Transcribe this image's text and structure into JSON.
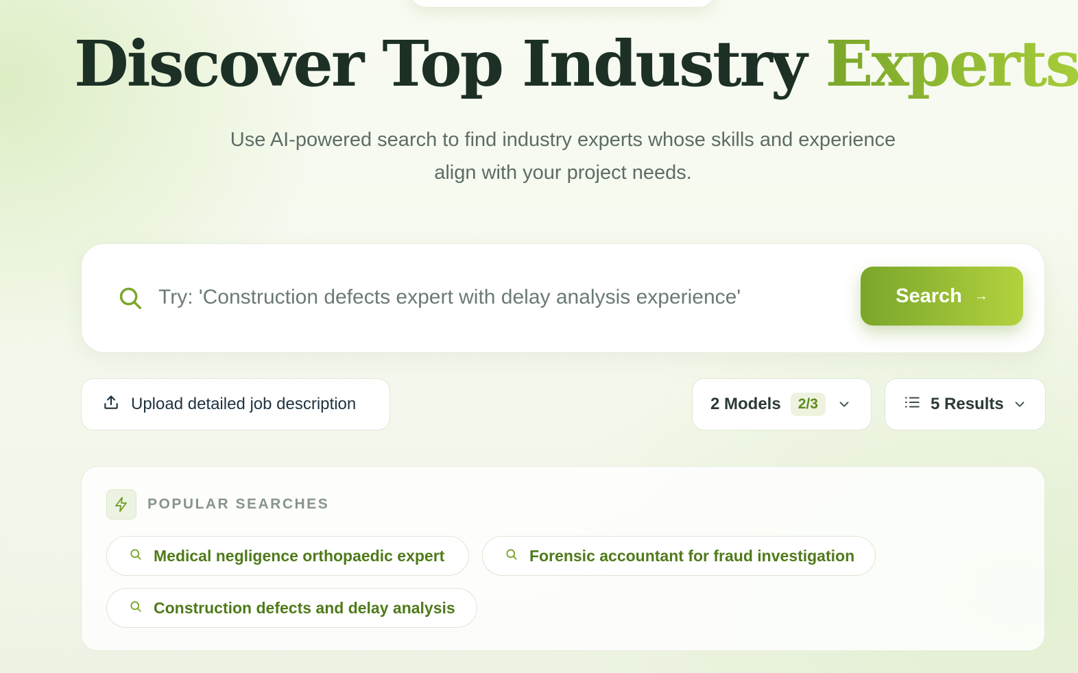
{
  "hero": {
    "title_main": "Discover Top Industry ",
    "title_accent": "Experts",
    "subtitle_line1": "Use AI-powered search to find industry experts whose skills and experience",
    "subtitle_line2": "align with your project needs."
  },
  "search": {
    "placeholder": "Try: 'Construction defects expert with delay analysis experience'",
    "value": "",
    "button_label": "Search",
    "button_arrow": "→",
    "icon": "search-icon"
  },
  "controls": {
    "upload_label": "Upload detailed job description",
    "upload_icon": "upload-icon",
    "models_label": "2 Models",
    "models_badge": "2/3",
    "results_label": "5 Results",
    "results_icon": "list-icon"
  },
  "popular": {
    "title": "POPULAR SEARCHES",
    "icon": "bolt-icon",
    "items": [
      {
        "label": "Medical negligence orthopaedic expert"
      },
      {
        "label": "Forensic accountant for fraud investigation"
      },
      {
        "label": "Construction defects and delay analysis"
      }
    ]
  },
  "colors": {
    "accent_start": "#7aa62a",
    "accent_end": "#b3d23e",
    "title_dark": "#1d3026",
    "chip_text": "#4f7a1a",
    "muted_text": "#5d6c66"
  }
}
